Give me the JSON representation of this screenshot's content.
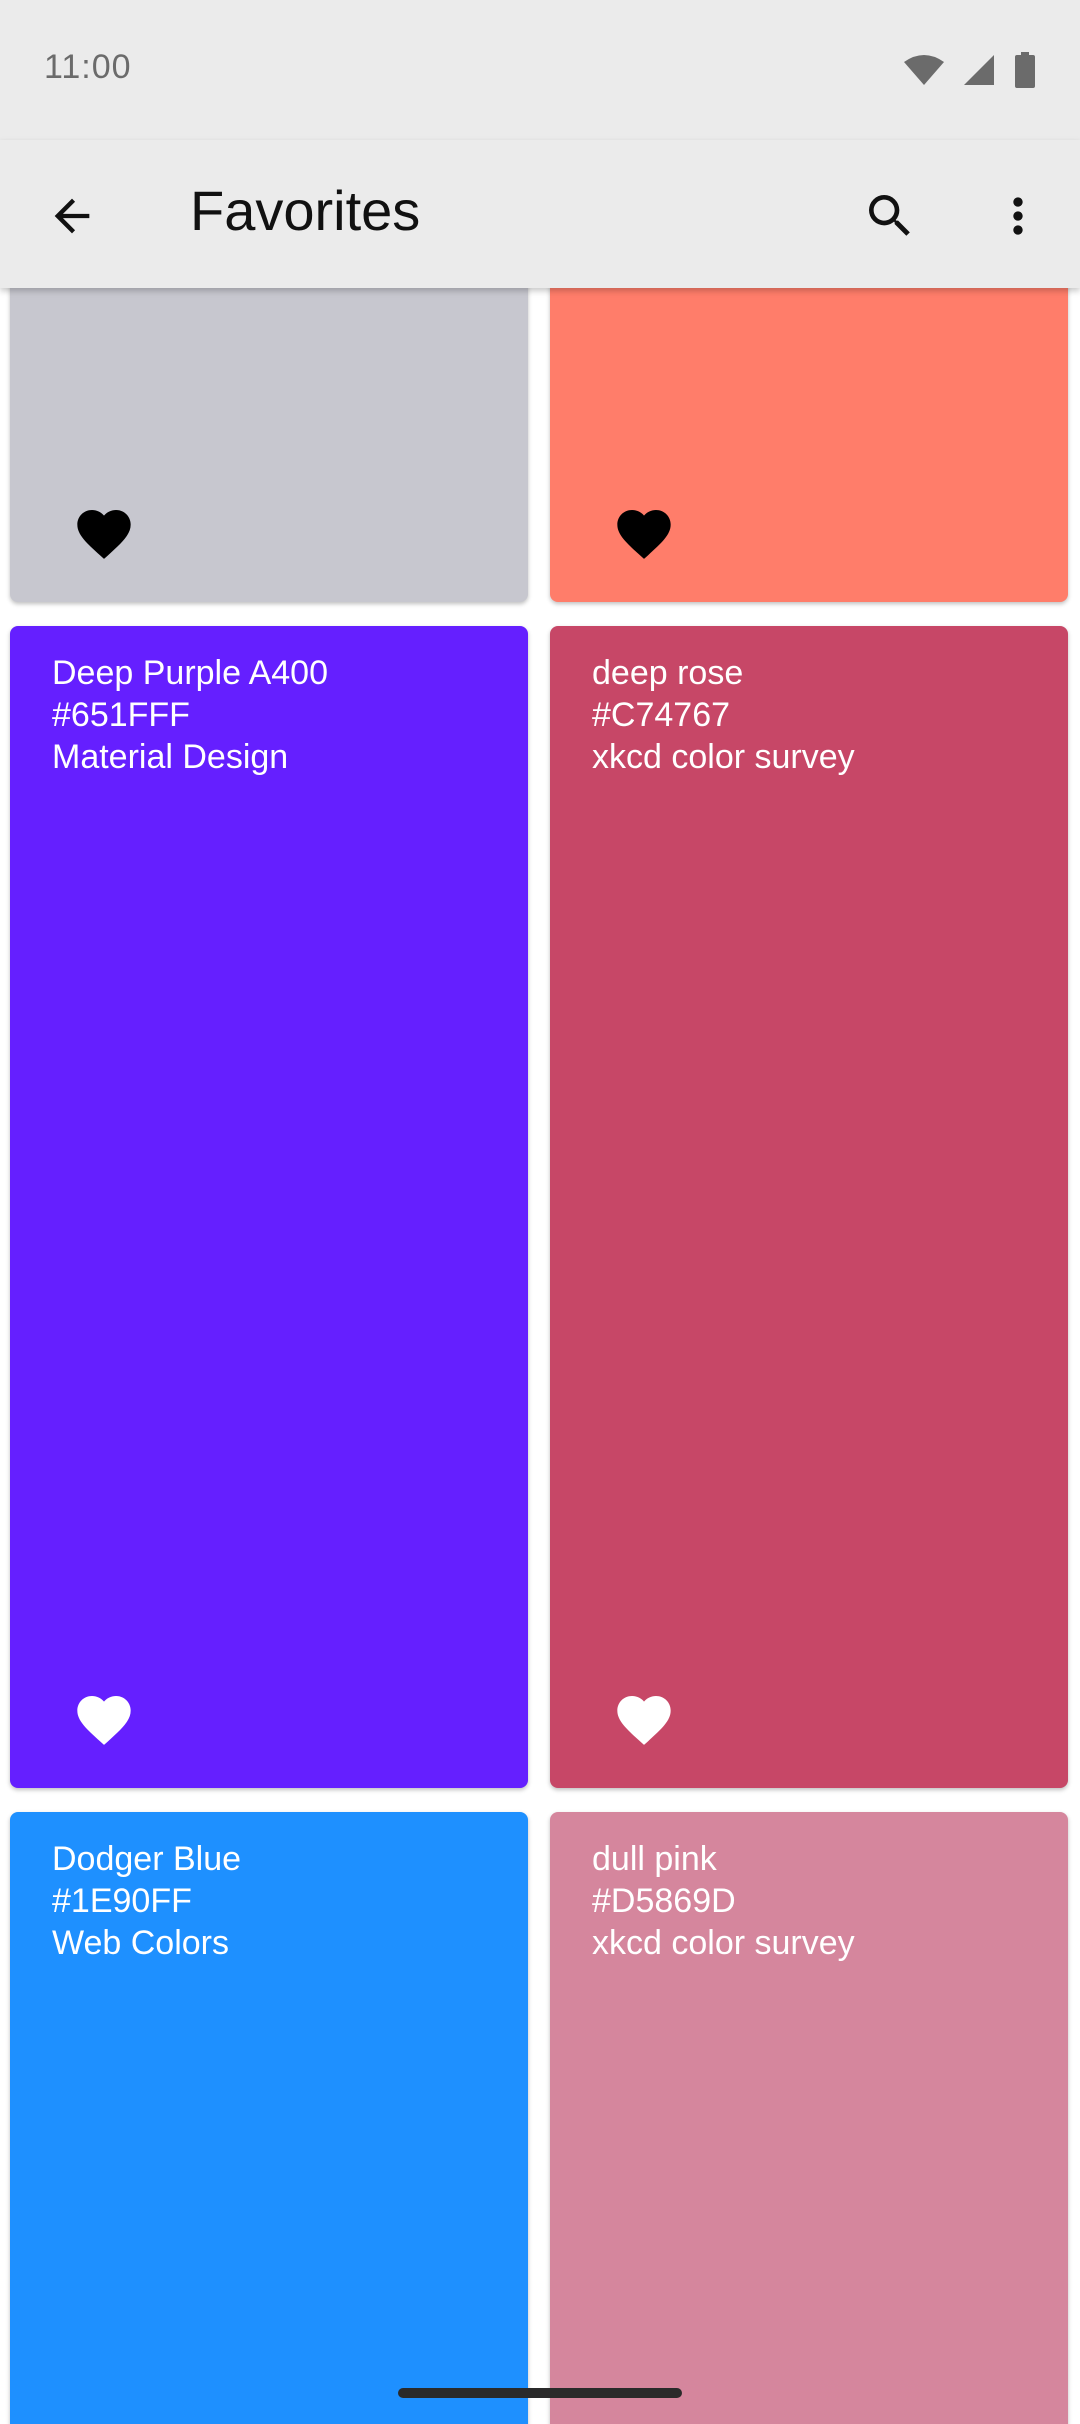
{
  "status_bar": {
    "time": "11:00",
    "icons": [
      "wifi-icon",
      "signal-icon",
      "battery-icon"
    ]
  },
  "app_bar": {
    "title": "Favorites",
    "back_icon": "arrow-back-icon",
    "search_icon": "search-icon",
    "more_icon": "more-vert-icon"
  },
  "cards": [
    {
      "name": "",
      "hex": "",
      "source": "",
      "color": "#C7C7CF",
      "heart_color": "#000000"
    },
    {
      "name": "",
      "hex": "",
      "source": "",
      "color": "#FF7D6A",
      "heart_color": "#000000"
    },
    {
      "name": "Deep Purple A400",
      "hex": "#651FFF",
      "source": "Material Design",
      "color": "#651FFF",
      "heart_color": "#FFFFFF"
    },
    {
      "name": "deep rose",
      "hex": "#C74767",
      "source": "xkcd color survey",
      "color": "#C74767",
      "heart_color": "#FFFFFF"
    },
    {
      "name": "Dodger Blue",
      "hex": "#1E90FF",
      "source": "Web Colors",
      "color": "#1E90FF",
      "heart_color": "#FFFFFF"
    },
    {
      "name": "dull pink",
      "hex": "#D5869D",
      "source": "xkcd color survey",
      "color": "#D5869D",
      "heart_color": "#FFFFFF"
    }
  ]
}
